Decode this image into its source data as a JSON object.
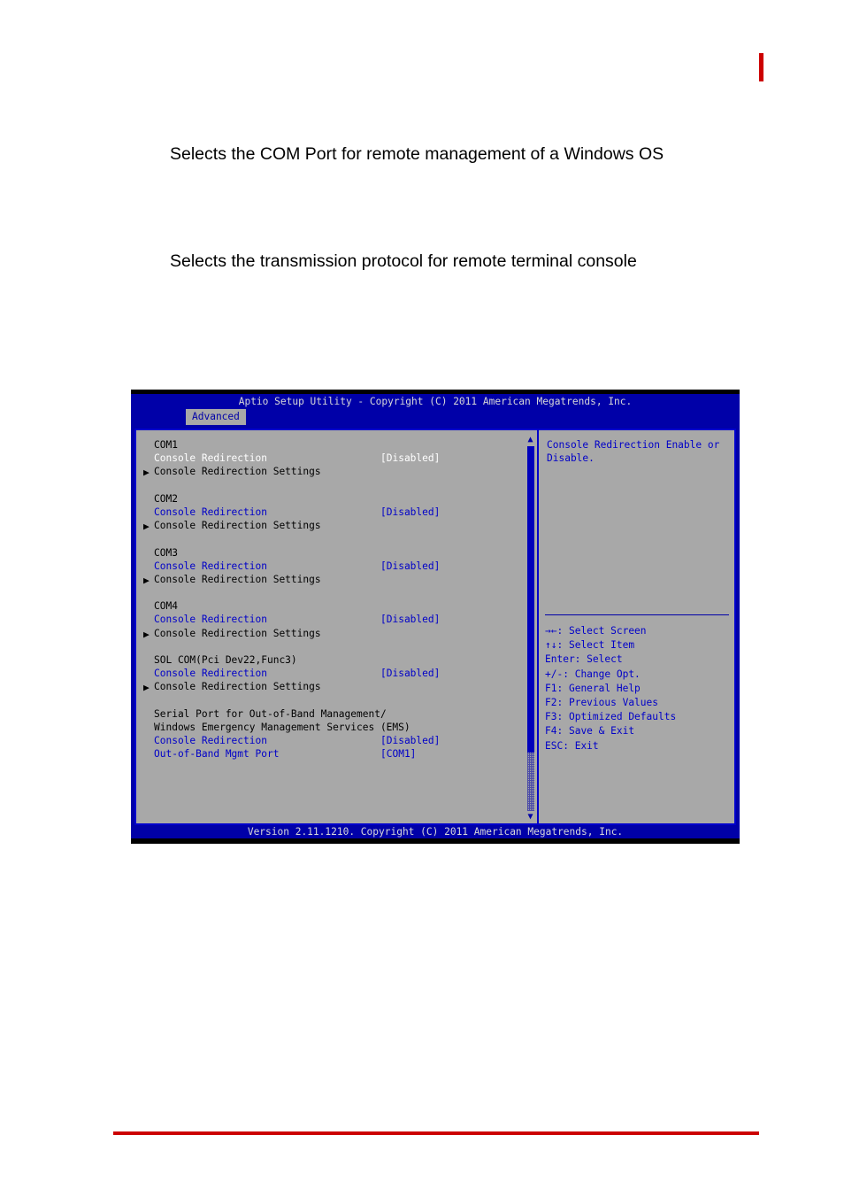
{
  "page": {
    "paragraphs": [
      "Selects the COM Port for remote management of a Windows OS",
      "Selects the transmission protocol for remote terminal console"
    ]
  },
  "bios": {
    "title": "Aptio Setup Utility - Copyright (C) 2011 American Megatrends, Inc.",
    "tab": "Advanced",
    "footer": "Version 2.11.1210. Copyright (C) 2011 American Megatrends, Inc.",
    "help": "Console Redirection Enable or Disable.",
    "scrollbar": {
      "up_glyph": "▲",
      "down_glyph": "▼"
    },
    "items": [
      {
        "kind": "header",
        "label": "COM1",
        "value": "",
        "arrow": ""
      },
      {
        "kind": "selected",
        "label": "Console Redirection",
        "value": "[Disabled]",
        "arrow": ""
      },
      {
        "kind": "submenu",
        "label": "Console Redirection Settings",
        "value": "",
        "arrow": "▶"
      },
      {
        "kind": "spacer",
        "label": "",
        "value": "",
        "arrow": ""
      },
      {
        "kind": "header",
        "label": "COM2",
        "value": "",
        "arrow": ""
      },
      {
        "kind": "option",
        "label": "Console Redirection",
        "value": "[Disabled]",
        "arrow": ""
      },
      {
        "kind": "submenu",
        "label": "Console Redirection Settings",
        "value": "",
        "arrow": "▶"
      },
      {
        "kind": "spacer",
        "label": "",
        "value": "",
        "arrow": ""
      },
      {
        "kind": "header",
        "label": "COM3",
        "value": "",
        "arrow": ""
      },
      {
        "kind": "option",
        "label": "Console Redirection",
        "value": "[Disabled]",
        "arrow": ""
      },
      {
        "kind": "submenu",
        "label": "Console Redirection Settings",
        "value": "",
        "arrow": "▶"
      },
      {
        "kind": "spacer",
        "label": "",
        "value": "",
        "arrow": ""
      },
      {
        "kind": "header",
        "label": "COM4",
        "value": "",
        "arrow": ""
      },
      {
        "kind": "option",
        "label": "Console Redirection",
        "value": "[Disabled]",
        "arrow": ""
      },
      {
        "kind": "submenu",
        "label": "Console Redirection Settings",
        "value": "",
        "arrow": "▶"
      },
      {
        "kind": "spacer",
        "label": "",
        "value": "",
        "arrow": ""
      },
      {
        "kind": "header",
        "label": "SOL COM(Pci Dev22,Func3)",
        "value": "",
        "arrow": ""
      },
      {
        "kind": "option",
        "label": "Console Redirection",
        "value": "[Disabled]",
        "arrow": ""
      },
      {
        "kind": "submenu",
        "label": "Console Redirection Settings",
        "value": "",
        "arrow": "▶"
      },
      {
        "kind": "spacer",
        "label": "",
        "value": "",
        "arrow": ""
      },
      {
        "kind": "header",
        "label": "Serial Port for Out-of-Band Management/",
        "value": "",
        "arrow": ""
      },
      {
        "kind": "header",
        "label": "Windows Emergency Management Services (EMS)",
        "value": "",
        "arrow": ""
      },
      {
        "kind": "option",
        "label": "Console Redirection",
        "value": "[Disabled]",
        "arrow": ""
      },
      {
        "kind": "option",
        "label": "Out-of-Band Mgmt Port",
        "value": "[COM1]",
        "arrow": ""
      }
    ],
    "keys": [
      {
        "key": "→←:",
        "action": "Select Screen"
      },
      {
        "key": "↑↓:",
        "action": "Select Item"
      },
      {
        "key": "Enter:",
        "action": "Select"
      },
      {
        "key": "+/-:",
        "action": "Change Opt."
      },
      {
        "key": "F1:",
        "action": "General Help"
      },
      {
        "key": "F2:",
        "action": "Previous Values"
      },
      {
        "key": "F3:",
        "action": "Optimized Defaults"
      },
      {
        "key": "F4:",
        "action": "Save & Exit"
      },
      {
        "key": "ESC:",
        "action": "Exit"
      }
    ]
  },
  "colors": {
    "bios_blue": "#0000a8",
    "bios_gray": "#a8a8a8",
    "bios_text_blue": "#0000c8",
    "accent_red": "#cc0000"
  }
}
